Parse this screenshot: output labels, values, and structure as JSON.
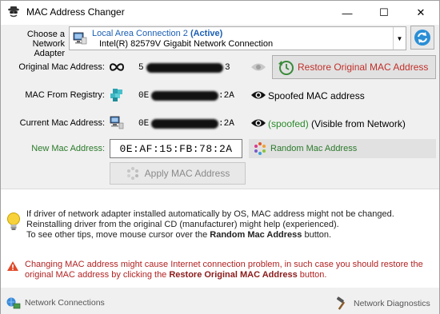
{
  "window": {
    "title": "MAC Address Changer",
    "controls": {
      "minimize": "—",
      "maximize": "☐",
      "close": "✕"
    }
  },
  "adapter": {
    "label_line1": "Choose a",
    "label_line2": "Network Adapter",
    "name": "Local Area Connection 2",
    "status": "(Active)",
    "description": "Intel(R) 82579V Gigabit Network Connection"
  },
  "original_mac": {
    "label": "Original Mac Address:",
    "prefix": "5",
    "suffix": "3"
  },
  "restore_button": {
    "label": "Restore Original MAC Address"
  },
  "registry_mac": {
    "label": "MAC From Registry:",
    "prefix": "0E",
    "suffix": ":2A",
    "status": "Spoofed MAC address"
  },
  "current_mac": {
    "label": "Current Mac Address:",
    "prefix": "0E",
    "suffix": ":2A",
    "status_spoofed": "(spoofed)",
    "status_rest": "(Visible from Network)"
  },
  "new_mac": {
    "label": "New Mac Address:",
    "value": "0E:AF:15:FB:78:2A"
  },
  "random_button": {
    "label": "Random Mac Address"
  },
  "apply_button": {
    "label": "Apply MAC Address"
  },
  "tip": {
    "line1": "If driver of network adapter installed automatically by OS, MAC address might not be changed.",
    "line2": "Reinstalling driver from the original CD (manufacturer) might help (experienced).",
    "line3_pre": "To see other tips, move mouse cursor over the ",
    "line3_bold": "Random Mac Address",
    "line3_post": " button."
  },
  "warning": {
    "line1": "Changing MAC address might cause Internet connection problem, in such case you should restore the",
    "line2_pre": "original MAC address by clicking the ",
    "line2_bold": "Restore Original MAC Address",
    "line2_post": " button."
  },
  "footer": {
    "network_connections": "Network Connections",
    "network_diagnostics": "Network Diagnostics"
  },
  "colors": {
    "accent_blue": "#1a5fb4",
    "restore_red": "#c0302a",
    "spoofed_green": "#2a8a2a",
    "warning_red": "#b22222"
  }
}
